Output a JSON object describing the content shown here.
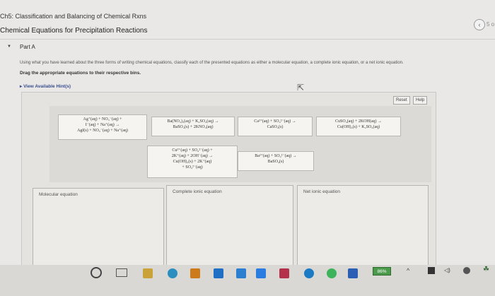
{
  "header": {
    "course_title": "Ch5: Classification and Balancing of Chemical Rxns",
    "assignment_title": "Chemical Equations for Precipitation Reactions",
    "page_indicator": "5 o"
  },
  "part": {
    "label": "Part A",
    "instruction": "Using what you have learned about the three forms of writing chemical equations, classify each of the presented equations as either a molecular equation, a complete ionic equation, or a net ionic equation.",
    "drag_instruction": "Drag the appropriate equations to their respective bins.",
    "hints_label": "View Available Hint(s)"
  },
  "buttons": {
    "reset": "Reset",
    "help": "Help"
  },
  "cards": [
    {
      "lines": [
        "Ag⁺(aq) + NO₃⁻(aq) +",
        "I⁻(aq) + Na⁺(aq) →",
        "AgI(s) + NO₃⁻(aq) + Na⁺(aq)"
      ]
    },
    {
      "lines": [
        "Ba(NO₃)₂(aq) + K₂SO₄(aq) →",
        "BaSO₄(s) + 2KNO₃(aq)"
      ]
    },
    {
      "lines": [
        "Ca²⁺(aq) + SO₄²⁻(aq) →",
        "CaSO₄(s)"
      ]
    },
    {
      "lines": [
        "CuSO₄(aq) + 2KOH(aq) →",
        "Cu(OH)₂(s) + K₂SO₄(aq)"
      ]
    },
    {
      "lines": [
        "Cu²⁺(aq) + SO₄²⁻(aq) +",
        "2K⁺(aq) + 2OH⁻(aq) →",
        "Cu(OH)₂(s) + 2K⁺(aq)",
        "+ SO₄²⁻(aq)"
      ]
    },
    {
      "lines": [
        "Ba²⁺(aq) + SO₄²⁻(aq) →",
        "BaSO₄(s)"
      ]
    }
  ],
  "bins": [
    {
      "label": "Molecular equation"
    },
    {
      "label": "Complete ionic equation"
    },
    {
      "label": "Net ionic equation"
    }
  ],
  "taskbar": {
    "battery": "86%",
    "icon_colors": [
      "#444444",
      "#c9a23a",
      "#2a8fbf",
      "#cc7a1a",
      "#1f6fc4",
      "#2a7fd1",
      "#b5304a",
      "#1a7ac4",
      "#2b7ce0",
      "#2e8b57"
    ]
  }
}
